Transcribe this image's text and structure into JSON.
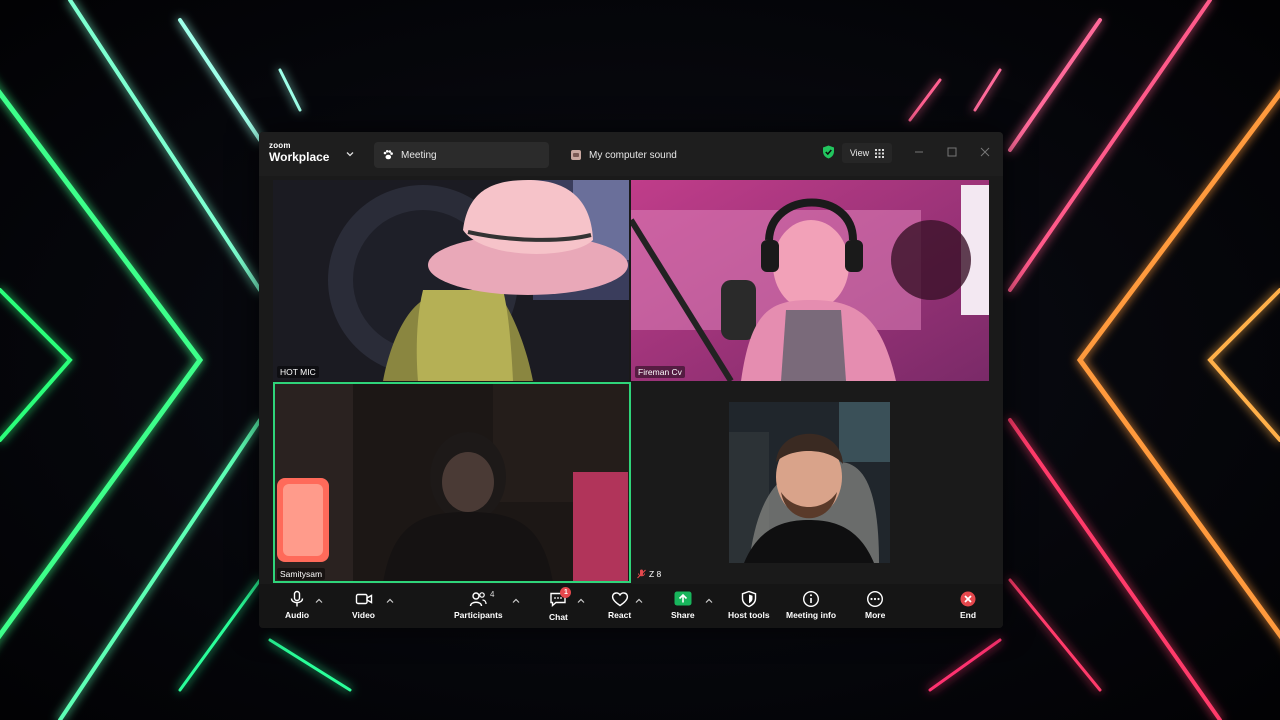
{
  "window": {
    "brand_top": "zoom",
    "brand_bottom": "Workplace",
    "tabs": [
      {
        "label": "Meeting",
        "icon": "paw-icon"
      },
      {
        "label": "My computer sound",
        "icon": "speaker-icon"
      }
    ],
    "view_label": "View",
    "colors": {
      "accent": "#2fd47a",
      "danger": "#e5484d",
      "share": "#18b55c"
    }
  },
  "tiles": {
    "hot_mic": "HOT MIC",
    "fireman": "Fireman Cv",
    "samitysam": "Samitysam",
    "z8": "Z 8"
  },
  "toolbar": {
    "audio": "Audio",
    "video": "Video",
    "participants": "Participants",
    "participants_count": "4",
    "chat": "Chat",
    "chat_badge": "1",
    "react": "React",
    "share": "Share",
    "host_tools": "Host tools",
    "meeting_info": "Meeting info",
    "more": "More",
    "end": "End"
  }
}
